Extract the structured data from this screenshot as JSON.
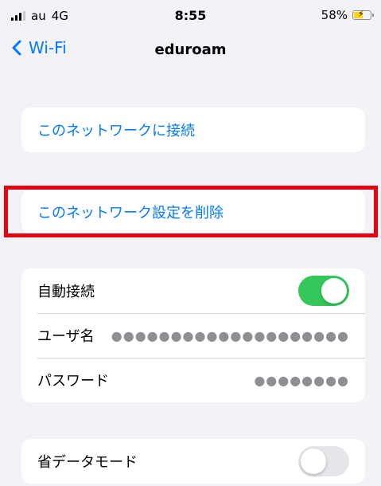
{
  "status_bar": {
    "carrier": "au",
    "network": "4G",
    "time": "8:55",
    "battery_percent": "58%",
    "signal_icon": "signal-bars-icon",
    "battery_icon": "battery-charging-icon"
  },
  "nav": {
    "back_label": "Wi-Fi",
    "back_icon": "chevron-left-icon",
    "title": "eduroam"
  },
  "connect_group": {
    "connect_label": "このネットワークに接続"
  },
  "forget_group": {
    "forget_label": "このネットワーク設定を削除"
  },
  "settings_group": {
    "auto_join_label": "自動接続",
    "auto_join_on": true,
    "username_label": "ユーザ名",
    "username_value": "●●●●●●●●●●●●●●●●●●●●",
    "password_label": "パスワード",
    "password_value": "●●●●●●●●"
  },
  "data_group": {
    "low_data_label": "省データモード",
    "low_data_on": false
  },
  "colors": {
    "accent": "#007aff",
    "toggle_on": "#34c759",
    "highlight": "#e60012",
    "background": "#f2f2f7"
  }
}
